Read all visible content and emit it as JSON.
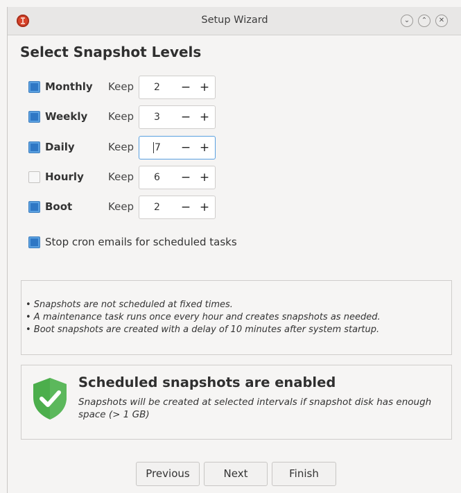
{
  "window": {
    "title": "Setup Wizard"
  },
  "page": {
    "heading": "Select Snapshot Levels"
  },
  "levels": [
    {
      "label": "Monthly",
      "checked": true,
      "keep_label": "Keep",
      "value": "2"
    },
    {
      "label": "Weekly",
      "checked": true,
      "keep_label": "Keep",
      "value": "3"
    },
    {
      "label": "Daily",
      "checked": true,
      "keep_label": "Keep",
      "value": "7",
      "focused": true
    },
    {
      "label": "Hourly",
      "checked": false,
      "keep_label": "Keep",
      "value": "6"
    },
    {
      "label": "Boot",
      "checked": true,
      "keep_label": "Keep",
      "value": "2"
    }
  ],
  "stepper": {
    "minus": "−",
    "plus": "+"
  },
  "cron": {
    "label": "Stop cron emails for scheduled tasks",
    "checked": true
  },
  "info": {
    "lines": [
      "• Snapshots are not scheduled at fixed times.",
      "• A maintenance task runs once every hour and creates snapshots as needed.",
      "• Boot snapshots are created with a delay of 10 minutes after system startup."
    ]
  },
  "status": {
    "title": "Scheduled snapshots are enabled",
    "message": "Snapshots will be created at selected intervals if snapshot disk has enough space (> 1 GB)",
    "icon": "shield-check-icon",
    "color": "#5cb85c"
  },
  "buttons": {
    "previous": "Previous",
    "next": "Next",
    "finish": "Finish"
  },
  "colors": {
    "checkbox": "#2f77c4",
    "focus": "#5aa0e0"
  }
}
